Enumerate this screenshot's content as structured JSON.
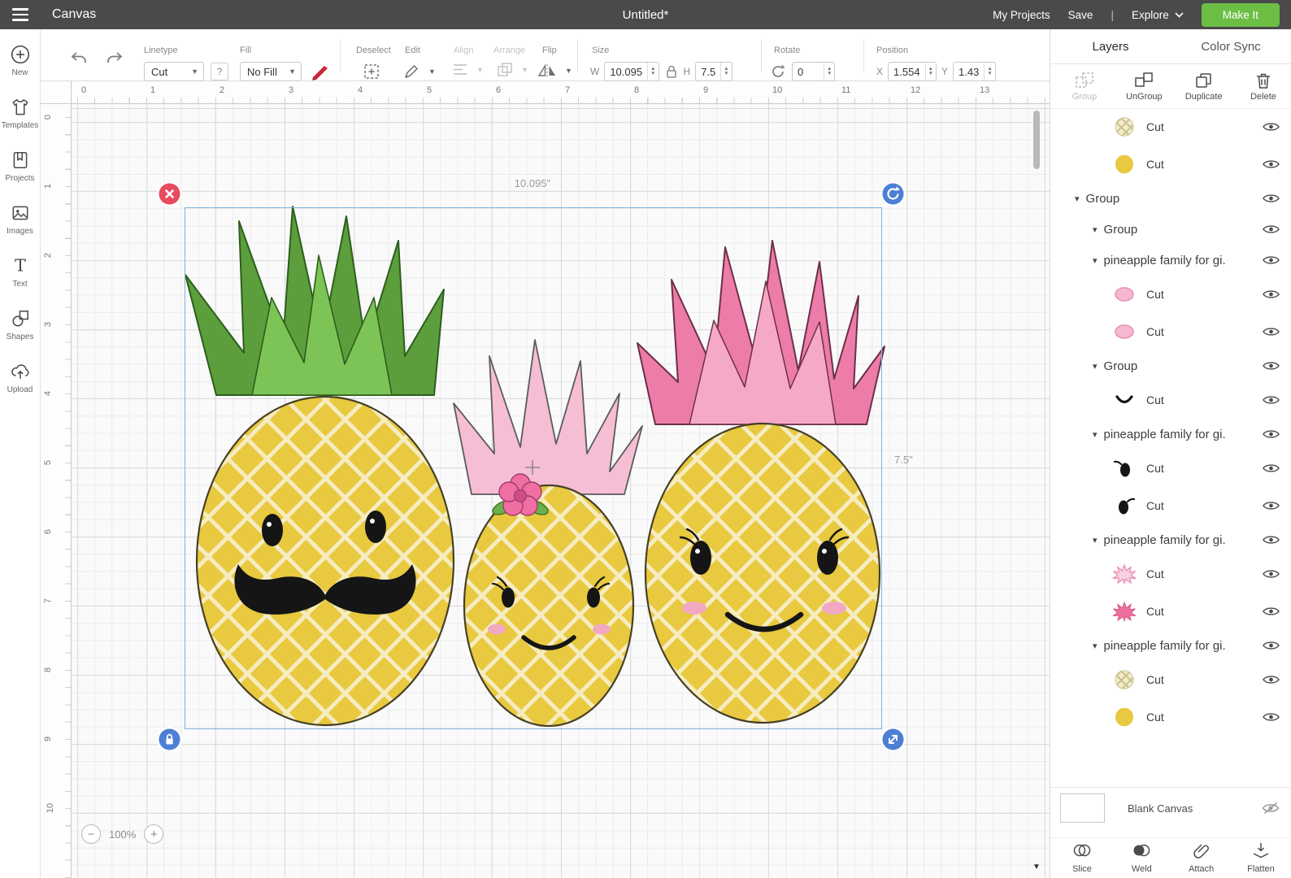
{
  "colors": {
    "header-bg": "#4a4a4a",
    "accent-green": "#6cbe45",
    "selection-blue": "#7fb0dd",
    "handle-red": "#e84a5f",
    "handle-blue": "#4d7fd4",
    "pineapple-yellow": "#e8c93f",
    "lattice-cream": "#f6ecc0",
    "leaf-green": "#6ab04c",
    "pink": "#ee7ca8",
    "pink-light": "#f6bed4"
  },
  "header": {
    "app_menu": "Canvas",
    "title": "Untitled*",
    "nav": {
      "my_projects": "My Projects",
      "save": "Save",
      "separator": "|",
      "explore": "Explore",
      "make_it": "Make It"
    }
  },
  "sidebar": {
    "items": [
      {
        "label": "New"
      },
      {
        "label": "Templates"
      },
      {
        "label": "Projects"
      },
      {
        "label": "Images"
      },
      {
        "label": "Text"
      },
      {
        "label": "Shapes"
      },
      {
        "label": "Upload"
      }
    ]
  },
  "toolbar": {
    "linetype": {
      "label": "Linetype",
      "value": "Cut",
      "help": "?"
    },
    "fill": {
      "label": "Fill",
      "value": "No Fill"
    },
    "deselect_label": "Deselect",
    "edit_label": "Edit",
    "align_label": "Align",
    "arrange_label": "Arrange",
    "flip_label": "Flip",
    "size": {
      "label": "Size",
      "w_label": "W",
      "w": "10.095",
      "h_label": "H",
      "h": "7.5"
    },
    "rotate": {
      "label": "Rotate",
      "value": "0"
    },
    "position": {
      "label": "Position",
      "x_label": "X",
      "x": "1.554",
      "y_label": "Y",
      "y": "1.43"
    }
  },
  "ruler": {
    "horizontal": [
      "0",
      "1",
      "2",
      "3",
      "4",
      "5",
      "6",
      "7",
      "8",
      "9",
      "10",
      "11",
      "12",
      "13"
    ],
    "vertical": [
      "0",
      "1",
      "2",
      "3",
      "4",
      "5",
      "6",
      "7",
      "8",
      "9",
      "10"
    ]
  },
  "canvas": {
    "selection": {
      "width_label": "10.095\"",
      "height_label": "7.5\""
    },
    "zoom": {
      "minus": "−",
      "value": "100%",
      "plus": "+"
    }
  },
  "layers_panel": {
    "tabs": [
      {
        "label": "Layers"
      },
      {
        "label": "Color Sync"
      }
    ],
    "actions": [
      {
        "label": "Group",
        "disabled": true
      },
      {
        "label": "UnGroup",
        "disabled": false
      },
      {
        "label": "Duplicate",
        "disabled": false
      },
      {
        "label": "Delete",
        "disabled": false
      }
    ],
    "rows": [
      {
        "type": "cut",
        "label": "Cut",
        "swatch": "pineapple-texture",
        "indent": 2
      },
      {
        "type": "cut",
        "label": "Cut",
        "swatch": "yellow-oval",
        "indent": 2
      },
      {
        "type": "group",
        "label": "Group",
        "indent": 0
      },
      {
        "type": "group",
        "label": "Group",
        "indent": 1
      },
      {
        "type": "group",
        "label": "pineapple family for gi...",
        "indent": 1
      },
      {
        "type": "cut",
        "label": "Cut",
        "swatch": "pink-oval",
        "indent": 2
      },
      {
        "type": "cut",
        "label": "Cut",
        "swatch": "pink-oval",
        "indent": 2
      },
      {
        "type": "group",
        "label": "Group",
        "indent": 1
      },
      {
        "type": "cut",
        "label": "Cut",
        "swatch": "smile",
        "indent": 2
      },
      {
        "type": "group",
        "label": "pineapple family for gi...",
        "indent": 1
      },
      {
        "type": "cut",
        "label": "Cut",
        "swatch": "eye-left",
        "indent": 2
      },
      {
        "type": "cut",
        "label": "Cut",
        "swatch": "eye-right",
        "indent": 2
      },
      {
        "type": "group",
        "label": "pineapple family for gi...",
        "indent": 1
      },
      {
        "type": "cut",
        "label": "Cut",
        "swatch": "pink-spiky-light",
        "indent": 2
      },
      {
        "type": "cut",
        "label": "Cut",
        "swatch": "pink-spiky",
        "indent": 2
      },
      {
        "type": "group",
        "label": "pineapple family for gi...",
        "indent": 1
      },
      {
        "type": "cut",
        "label": "Cut",
        "swatch": "pineapple-texture",
        "indent": 2
      },
      {
        "type": "cut",
        "label": "Cut",
        "swatch": "yellow-oval",
        "indent": 2
      }
    ],
    "blank_canvas": {
      "label": "Blank Canvas"
    },
    "bottom_actions": [
      {
        "label": "Slice"
      },
      {
        "label": "Weld"
      },
      {
        "label": "Attach"
      },
      {
        "label": "Flatten"
      }
    ]
  }
}
